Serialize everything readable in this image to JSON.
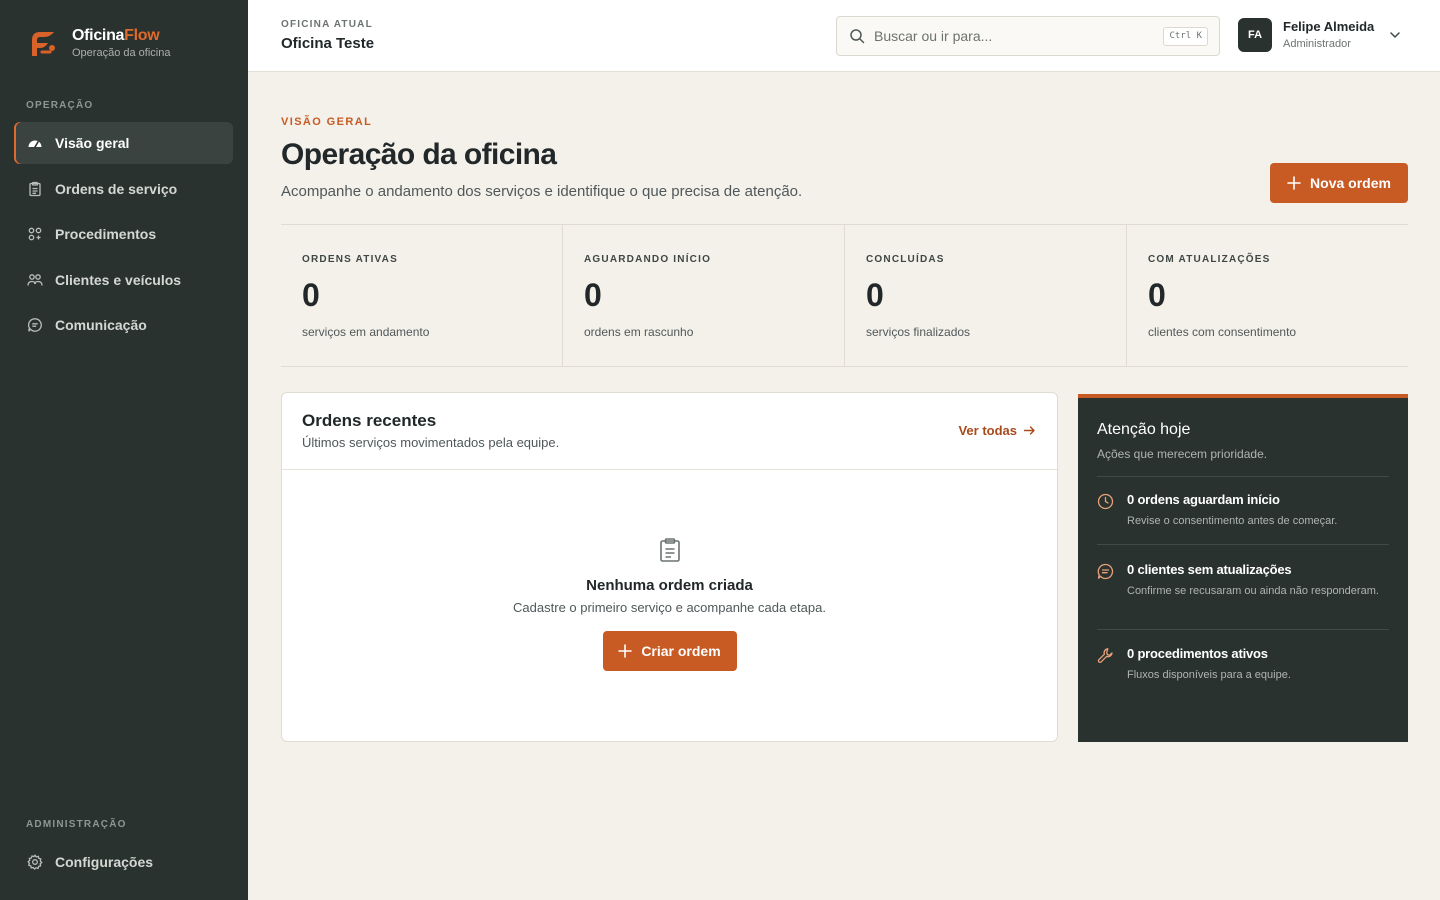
{
  "brand": {
    "name_main": "Oficina",
    "name_accent": "Flow",
    "subtitle": "Operação da oficina"
  },
  "sidebar": {
    "section_operation": "OPERAÇÃO",
    "items": [
      {
        "label": "Visão geral",
        "icon": "dashboard-gauge-icon",
        "active": true
      },
      {
        "label": "Ordens de serviço",
        "icon": "clipboard-icon"
      },
      {
        "label": "Procedimentos",
        "icon": "grid-nodes-icon"
      },
      {
        "label": "Clientes e veículos",
        "icon": "users-icon"
      },
      {
        "label": "Comunicação",
        "icon": "chat-bubble-icon"
      }
    ],
    "section_admin": "ADMINISTRAÇÃO",
    "admin_items": [
      {
        "label": "Configurações",
        "icon": "gear-icon"
      }
    ]
  },
  "topbar": {
    "workshop_label": "OFICINA ATUAL",
    "workshop_name": "Oficina Teste",
    "search_placeholder": "Buscar ou ir para...",
    "search_shortcut": "Ctrl K",
    "user": {
      "initials": "FA",
      "name": "Felipe Almeida",
      "role": "Administrador"
    }
  },
  "page": {
    "eyebrow": "VISÃO GERAL",
    "title": "Operação da oficina",
    "subtitle": "Acompanhe o andamento dos serviços e identifique o que precisa de atenção.",
    "new_order_label": "Nova ordem"
  },
  "stats": [
    {
      "label": "ORDENS ATIVAS",
      "value": "0",
      "desc": "serviços em andamento"
    },
    {
      "label": "AGUARDANDO INÍCIO",
      "value": "0",
      "desc": "ordens em rascunho"
    },
    {
      "label": "CONCLUÍDAS",
      "value": "0",
      "desc": "serviços finalizados"
    },
    {
      "label": "COM ATUALIZAÇÕES",
      "value": "0",
      "desc": "clientes com consentimento"
    }
  ],
  "recent": {
    "title": "Ordens recentes",
    "subtitle": "Últimos serviços movimentados pela equipe.",
    "see_all": "Ver todas",
    "empty_title": "Nenhuma ordem criada",
    "empty_subtitle": "Cadastre o primeiro serviço e acompanhe cada etapa.",
    "create_label": "Criar ordem"
  },
  "attention": {
    "title": "Atenção hoje",
    "subtitle": "Ações que merecem prioridade.",
    "items": [
      {
        "icon": "clock-icon",
        "title": "0 ordens aguardam início",
        "desc": "Revise o consentimento antes de começar."
      },
      {
        "icon": "message-icon",
        "title": "0 clientes sem atualizações",
        "desc": "Confirme se recusaram ou ainda não responderam."
      },
      {
        "icon": "wrench-icon",
        "title": "0 procedimentos ativos",
        "desc": "Fluxos disponíveis para a equipe."
      }
    ]
  },
  "colors": {
    "accent": "#c85a24",
    "sidebar_bg": "#2a3230",
    "page_bg": "#f4f1ea"
  }
}
